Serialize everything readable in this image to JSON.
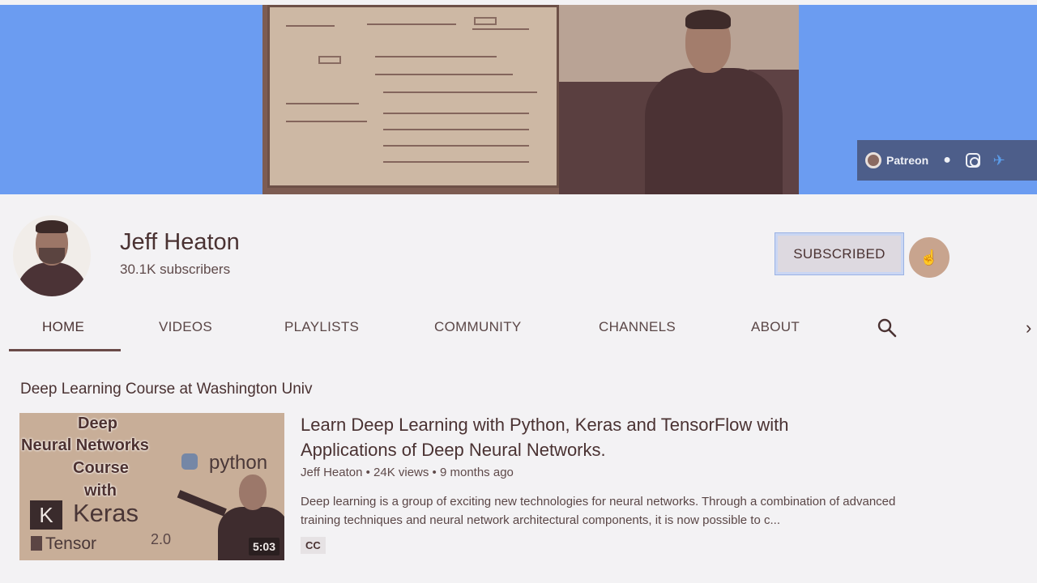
{
  "banner": {
    "social_links": [
      {
        "label": "Patreon",
        "icon": "patreon-icon"
      },
      {
        "label": "",
        "icon": "globe-icon"
      },
      {
        "label": "",
        "icon": "instagram-icon"
      },
      {
        "label": "",
        "icon": "twitter-icon"
      }
    ]
  },
  "channel": {
    "name": "Jeff Heaton",
    "subscribers": "30.1K subscribers",
    "subscribe_label": "SUBSCRIBED"
  },
  "tabs": [
    {
      "label": "HOME",
      "active": true
    },
    {
      "label": "VIDEOS"
    },
    {
      "label": "PLAYLISTS"
    },
    {
      "label": "COMMUNITY"
    },
    {
      "label": "CHANNELS"
    },
    {
      "label": "ABOUT"
    }
  ],
  "shelf": {
    "title": "Deep Learning Course at Washington Univ",
    "video": {
      "thumbnail_text": {
        "line1": "Deep",
        "line2": "Neural Networks",
        "line3": "Course",
        "line4": "with",
        "python": "python",
        "k": "K",
        "keras": "Keras",
        "tensor": "Tensor",
        "version": "2.0"
      },
      "duration": "5:03",
      "title": "Learn Deep Learning with Python, Keras and TensorFlow with Applications of Deep Neural Networks.",
      "meta": "Jeff Heaton • 24K views • 9 months ago",
      "description": "Deep learning is a group of exciting new technologies for neural networks. Through a combination of advanced training techniques and neural network architectural components, it is now possible to c...",
      "badge": "CC"
    }
  },
  "colors": {
    "banner_blue": "#6b9cf1",
    "background": "#f3f2f4",
    "text_primary": "#4a3232"
  }
}
